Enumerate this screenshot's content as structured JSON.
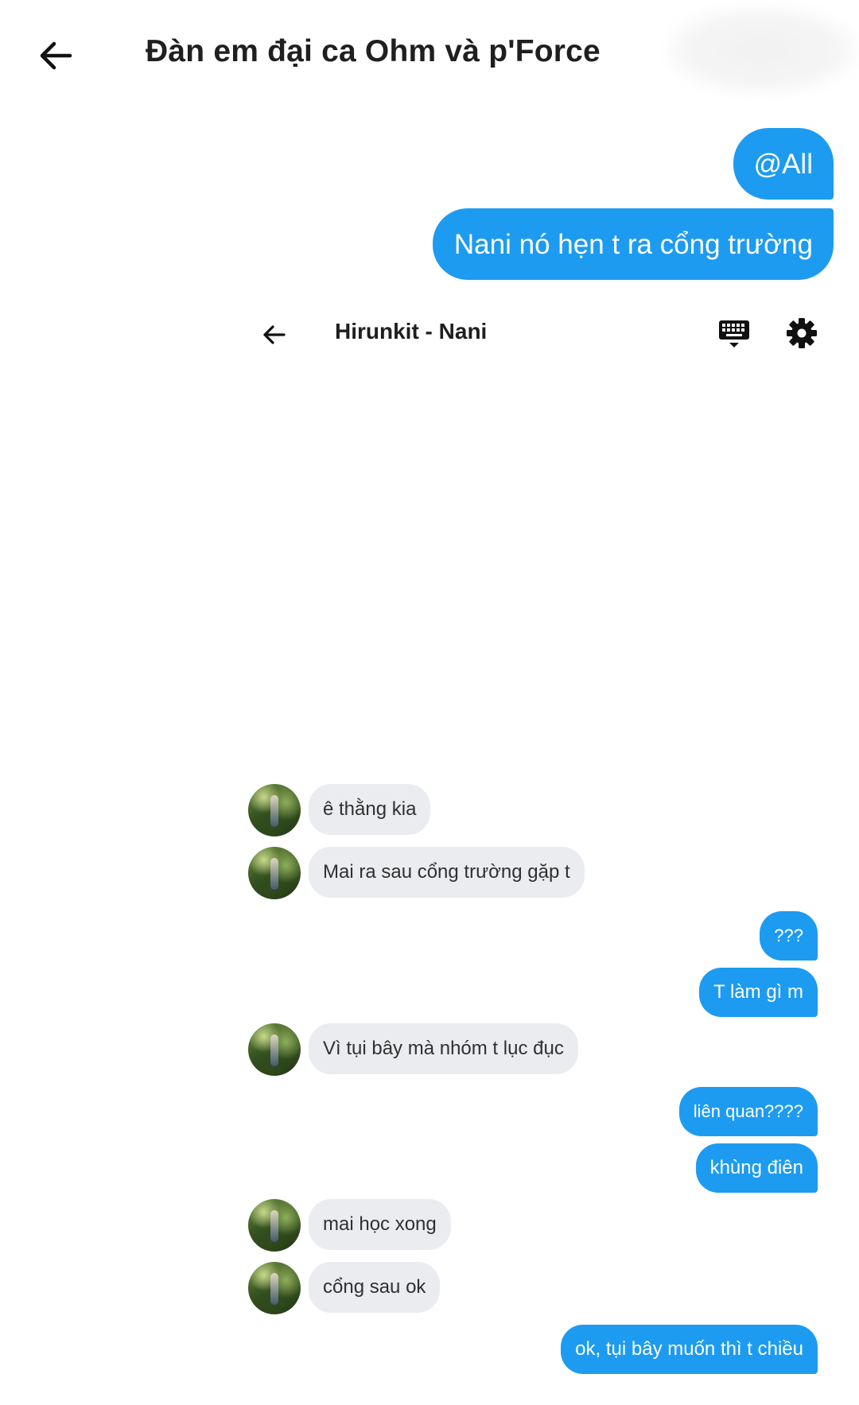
{
  "outer_chat": {
    "title": "Đàn em đại ca Ohm và p'Force",
    "messages": [
      {
        "text": "@All"
      },
      {
        "text": "Nani nó hẹn t ra cổng trường"
      }
    ]
  },
  "inner_chat": {
    "title": "Hirunkit - Nani",
    "messages": [
      {
        "side": "in",
        "text": "ê thằng kia"
      },
      {
        "side": "in",
        "text": "Mai ra sau cổng trường gặp t"
      },
      {
        "side": "out",
        "text": "???"
      },
      {
        "side": "out",
        "text": "T làm gì m"
      },
      {
        "side": "in",
        "text": "Vì tụi bây mà nhóm t lục đục"
      },
      {
        "side": "out",
        "text": "liên quan????"
      },
      {
        "side": "out",
        "text": "khùng điên"
      },
      {
        "side": "in",
        "text": "mai học xong"
      },
      {
        "side": "in",
        "text": "cổng sau ok"
      },
      {
        "side": "out",
        "text": "ok, tụi bây muốn thì t chiều"
      }
    ]
  },
  "icons": {
    "outer_back": "arrow-left-icon",
    "inner_back": "arrow-left-icon",
    "keyboard": "keyboard-icon",
    "settings": "gear-icon"
  },
  "colors": {
    "outgoing_bubble": "#1d9bf0",
    "incoming_bubble": "#eaecef",
    "background": "#ffffff"
  }
}
